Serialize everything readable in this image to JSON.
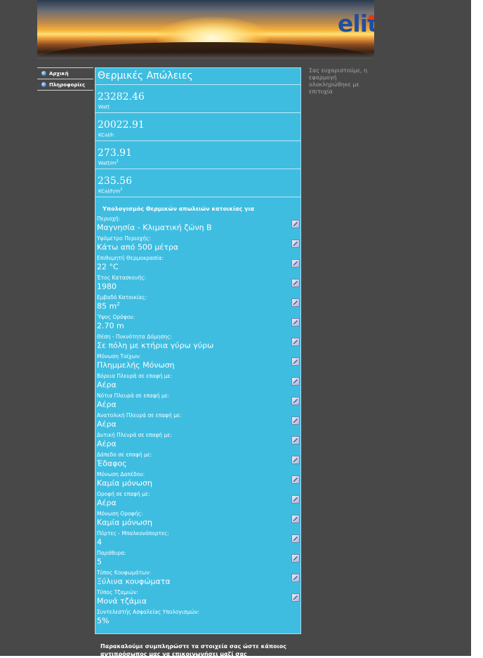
{
  "header": {
    "logo_text": "elith",
    "logo_color": "#1f4fa0",
    "accent_color": "#e03a1a"
  },
  "nav": {
    "items": [
      {
        "label": "Αρχική",
        "icon": "globe-icon"
      },
      {
        "label": "Πληροφορίες",
        "icon": "globe-info-icon"
      }
    ]
  },
  "main": {
    "title": "Θερμικές Απώλειες",
    "results": [
      {
        "value": "23282.46",
        "unit": "Watt",
        "unit_sup": ""
      },
      {
        "value": "20022.91",
        "unit": "KCal/h",
        "unit_sup": ""
      },
      {
        "value": "273.91",
        "unit": "Watt/m",
        "unit_sup": "2"
      },
      {
        "value": "235.56",
        "unit": "KCal/h/m",
        "unit_sup": "2"
      }
    ],
    "section_title": "Υπολογισμός Θερμικών απωλειών κατοικίας για",
    "fields": [
      {
        "label": "Περιοχή:",
        "value": "Μαγνησία - Κλιματική ζώνη Β",
        "value_sup": ""
      },
      {
        "label": "Υψόμετρο Περιοχής:",
        "value": "Κάτω από 500 μέτρα",
        "value_sup": ""
      },
      {
        "label": "Επιθυμητή Θερμοκρασία:",
        "value": "22 °C",
        "value_sup": ""
      },
      {
        "label": "Έτος Κατασκευής:",
        "value": "1980",
        "value_sup": ""
      },
      {
        "label": "Εμβαδό Κατοικίας:",
        "value": "85 m",
        "value_sup": "2"
      },
      {
        "label": "Ύψος Ορόφου:",
        "value": "2.70 m",
        "value_sup": ""
      },
      {
        "label": "Θέση - Πυκνότητα Δόμησης:",
        "value": "Σε πόλη με κτήρια γύρω γύρω",
        "value_sup": ""
      },
      {
        "label": "Μόνωση Τοίχων:",
        "value": "Πλημμελής Μόνωση",
        "value_sup": ""
      },
      {
        "label": "Βόρεια Πλευρά σε επαφή με:",
        "value": "Αέρα",
        "value_sup": ""
      },
      {
        "label": "Νότια Πλευρά σε επαφή με:",
        "value": "Αέρα",
        "value_sup": ""
      },
      {
        "label": "Ανατολική Πλευρά σε επαφή με:",
        "value": "Αέρα",
        "value_sup": ""
      },
      {
        "label": "Δυτική Πλευρά σε επαφή με:",
        "value": "Αέρα",
        "value_sup": ""
      },
      {
        "label": "Δάπεδο σε επαφή με:",
        "value": "Έδαφος",
        "value_sup": ""
      },
      {
        "label": "Μόνωση Δαπέδου:",
        "value": "Καμία μόνωση",
        "value_sup": ""
      },
      {
        "label": "Οροφή σε επαφή με:",
        "value": "Αέρα",
        "value_sup": ""
      },
      {
        "label": "Μόνωση Οροφής:",
        "value": "Καμία μόνωση",
        "value_sup": ""
      },
      {
        "label": "Πόρτες - Μπαλκονόπορτες:",
        "value": "4",
        "value_sup": ""
      },
      {
        "label": "Παράθυρα:",
        "value": "5",
        "value_sup": ""
      },
      {
        "label": "Τύπος Κουφωμάτων:",
        "value": "Ξύλινα κουφώματα",
        "value_sup": ""
      },
      {
        "label": "Τύπος Τζαμιών:",
        "value": "Μονά τζάμια",
        "value_sup": ""
      },
      {
        "label": "Συντελεστής Ασφαλείας Υπολογισμών:",
        "value": "5%",
        "value_sup": ""
      }
    ],
    "editable_field_count": 20,
    "panel_color": "#3ebde1"
  },
  "sidebar_message": "Σας ευχαριστούμε, η εφαρμογή ολοκληρώθηκε με επιτυχία",
  "footer_note": "Παρακαλούμε συμπληρώστε τα στοιχεία σας ώστε κάποιος αντιπρόσωπος μας να επικοινωνήσει μαζί σας"
}
